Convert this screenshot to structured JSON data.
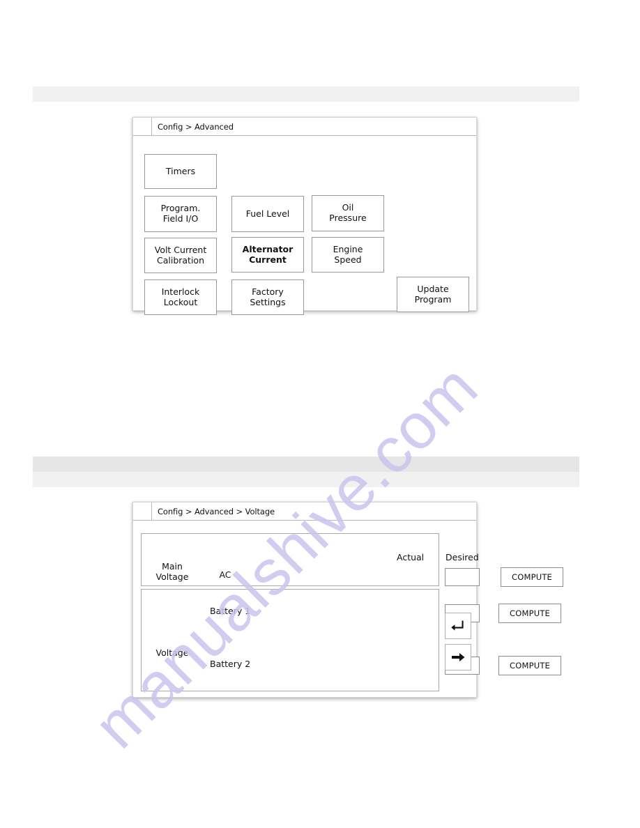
{
  "page": {
    "background_color": "#ffffff",
    "watermark_text": "manualshive.com",
    "watermark_color": "#c9c5ee"
  },
  "section_bars": [
    {
      "id": "bar-1",
      "label": ""
    },
    {
      "id": "bar-2",
      "label": ""
    },
    {
      "id": "bar-3",
      "label": ""
    }
  ],
  "panel_advanced": {
    "breadcrumb": "Config > Advanced",
    "buttons": [
      {
        "key": "timers",
        "label": "Timers",
        "emphasis": false
      },
      {
        "key": "prog_field_io",
        "label": "Program.\nField I/O",
        "emphasis": false
      },
      {
        "key": "fuel_level",
        "label": "Fuel Level",
        "emphasis": false
      },
      {
        "key": "oil_pressure",
        "label": "Oil\nPressure",
        "emphasis": false
      },
      {
        "key": "volt_current",
        "label": "Volt Current\nCalibration",
        "emphasis": false
      },
      {
        "key": "alternator",
        "label": "Alternator\nCurrent",
        "emphasis": true
      },
      {
        "key": "engine_speed",
        "label": "Engine\nSpeed",
        "emphasis": false
      },
      {
        "key": "interlock",
        "label": "Interlock\nLockout",
        "emphasis": false
      },
      {
        "key": "factory",
        "label": "Factory\nSettings",
        "emphasis": false
      },
      {
        "key": "update",
        "label": "Update\nProgram",
        "emphasis": false
      }
    ]
  },
  "panel_voltage": {
    "breadcrumb": "Config > Advanced >  Voltage",
    "column_headers": {
      "actual": "Actual",
      "desired": "Desired"
    },
    "groups": {
      "main": {
        "group_label": "Main\nVoltage",
        "row_label": "AC",
        "desired_value": "",
        "compute_label": "COMPUTE"
      },
      "battery": {
        "group_label": "Voltage",
        "rows": [
          {
            "row_label": "Battery 1",
            "desired_value": "",
            "compute_label": "COMPUTE"
          },
          {
            "row_label": "Battery 2",
            "desired_value": "",
            "compute_label": "COMPUTE"
          }
        ]
      }
    },
    "nav": {
      "back_icon": "back-arrow-icon",
      "forward_icon": "right-arrow-icon"
    }
  }
}
